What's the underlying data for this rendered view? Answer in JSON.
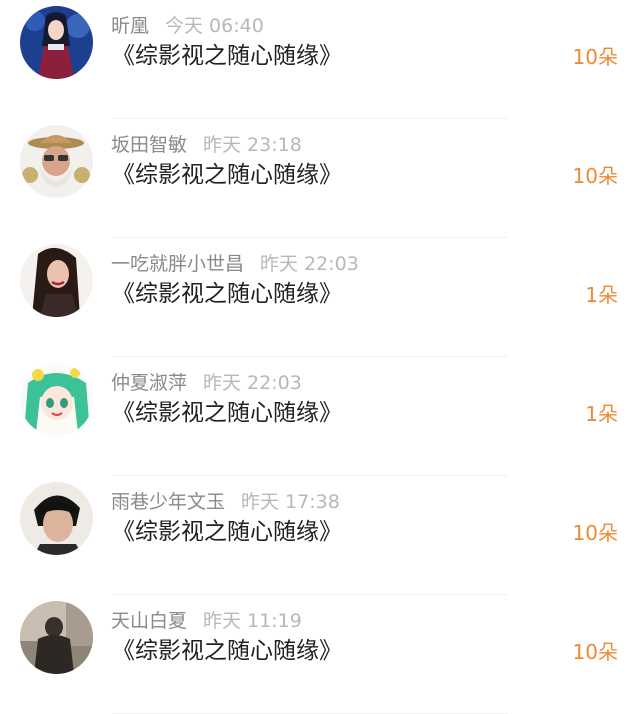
{
  "items": [
    {
      "name": "昕凰",
      "time": "今天 06:40",
      "title": "《综影视之随心随缘》",
      "count": "10朵",
      "avatar": "anime-girl-avatar"
    },
    {
      "name": "坂田智敏",
      "time": "昨天 23:18",
      "title": "《综影视之随心随缘》",
      "count": "10朵",
      "avatar": "cowboy-old-man-avatar"
    },
    {
      "name": "一吃就胖小世昌",
      "time": "昨天 22:03",
      "title": "《综影视之随心随缘》",
      "count": "1朵",
      "avatar": "woman-portrait-avatar"
    },
    {
      "name": "仲夏淑萍",
      "time": "昨天 22:03",
      "title": "《综影视之随心随缘》",
      "count": "1朵",
      "avatar": "green-hair-anime-avatar"
    },
    {
      "name": "雨巷少年文玉",
      "time": "昨天 17:38",
      "title": "《综影视之随心随缘》",
      "count": "10朵",
      "avatar": "young-man-avatar"
    },
    {
      "name": "天山白夏",
      "time": "昨天 11:19",
      "title": "《综影视之随心随缘》",
      "count": "10朵",
      "avatar": "street-photo-avatar"
    }
  ],
  "colors": {
    "name": "#8a8a8a",
    "time": "#b8b8b8",
    "title": "#222222",
    "count": "#ef8a34",
    "divider": "#f0f0f0"
  }
}
